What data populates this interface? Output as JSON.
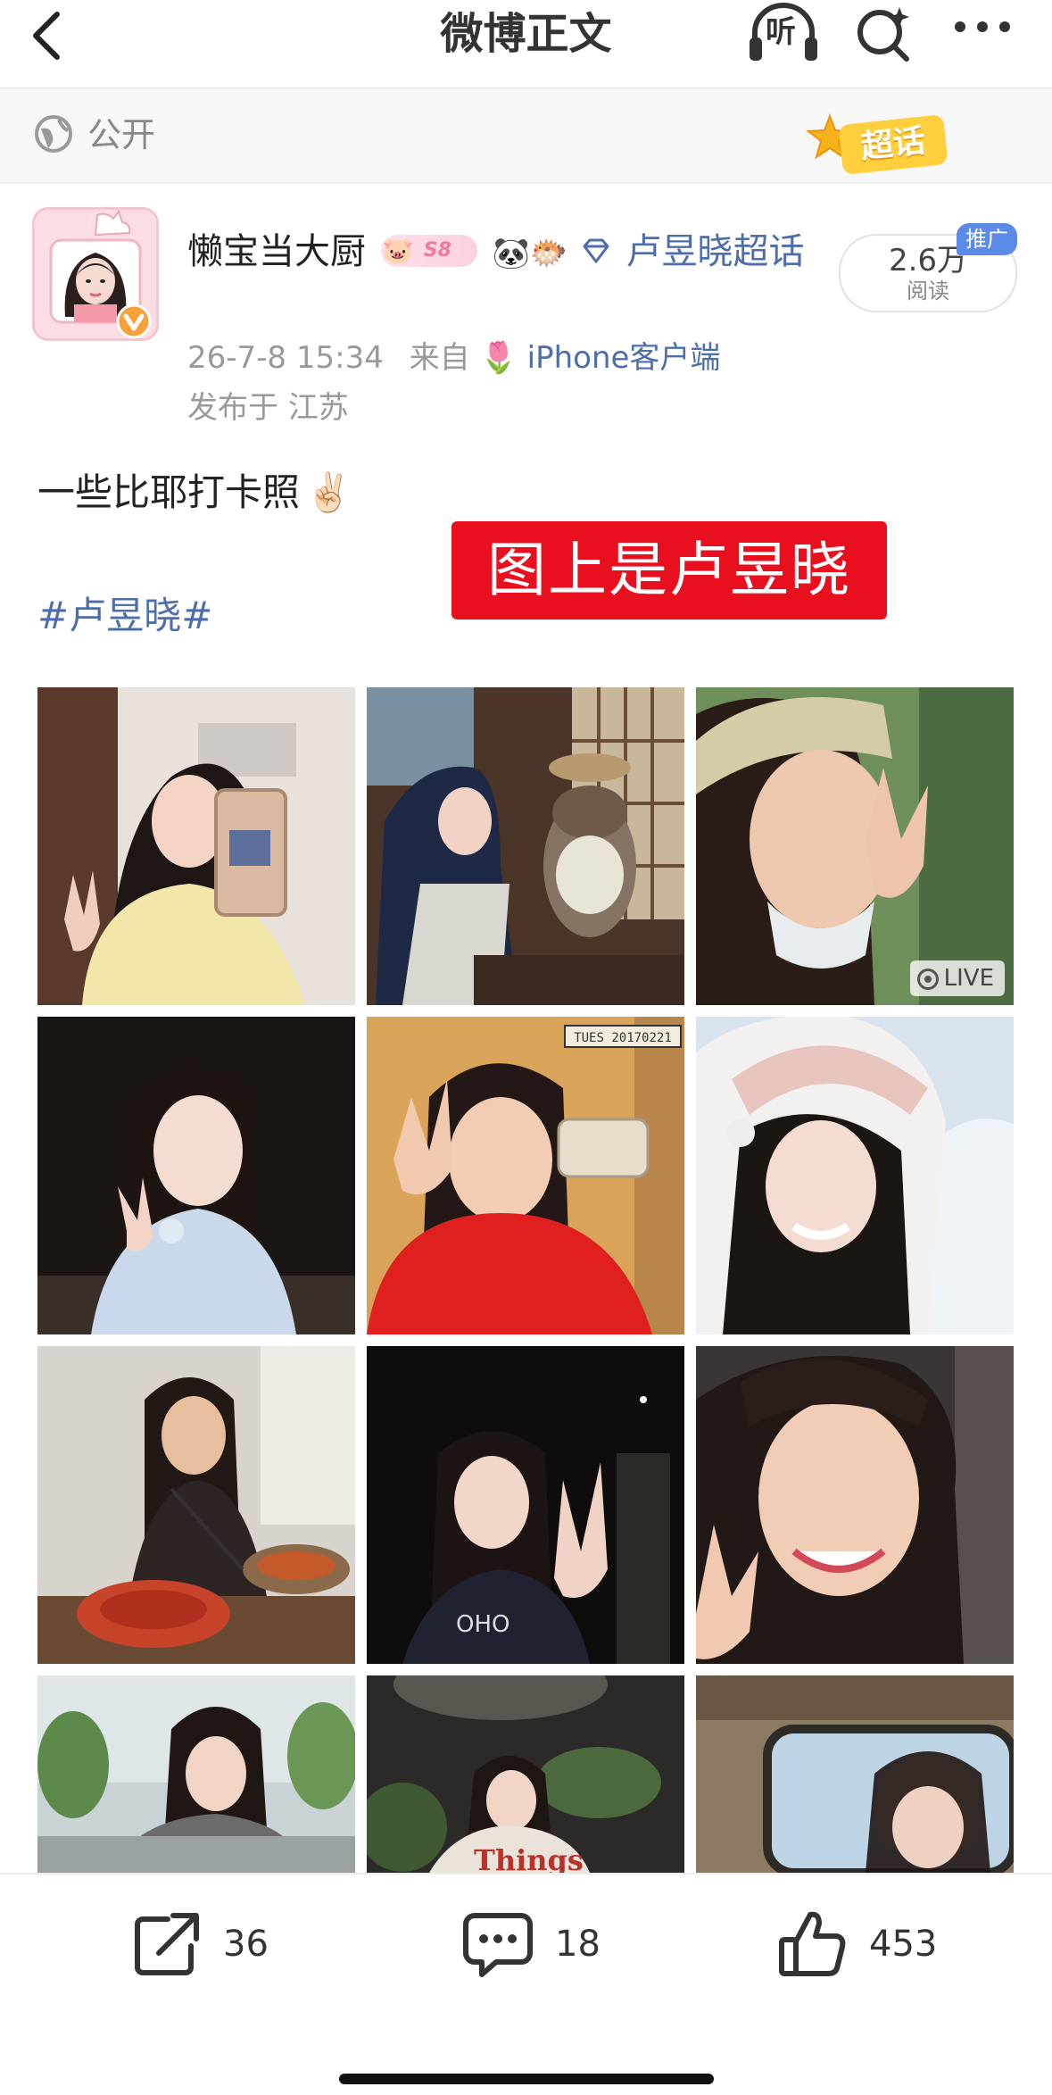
{
  "header": {
    "title": "微博正文",
    "back_icon": "chevron-left-icon",
    "listen_label": "听",
    "search_icon": "search-sparkle-icon",
    "more_icon": "more-dots-icon"
  },
  "visibility": {
    "icon": "globe-icon",
    "label": "公开",
    "supertopic_badge": "超话"
  },
  "author": {
    "name": "懒宝当大厨",
    "level_badge": "S8",
    "emoji_badges": "🐼🐡",
    "topic_link": "卢昱晓超话",
    "verified_icon": "verified-v-icon",
    "time": "26-7-8 15:34",
    "source_prefix": "来自",
    "source_emoji": "🌷",
    "source": "iPhone客户端",
    "location": "发布于 江苏"
  },
  "reads": {
    "count": "2.6万",
    "label": "阅读",
    "ad_tag": "推广"
  },
  "post": {
    "text": "一些比耶打卡照",
    "emoji": "✌🏻",
    "hashtag": "#卢昱晓#",
    "overlay_label": "图上是卢昱晓"
  },
  "photos": {
    "live_label": "LIVE",
    "stamp_text": "TUES 20170221",
    "sweater_text": "Things",
    "shirt_text": "OHO"
  },
  "footer": {
    "repost_count": "36",
    "comment_count": "18",
    "like_count": "453"
  },
  "colors": {
    "link": "#4d6ea8",
    "ad_badge": "#5b8be6",
    "red_overlay": "#e8101e"
  }
}
